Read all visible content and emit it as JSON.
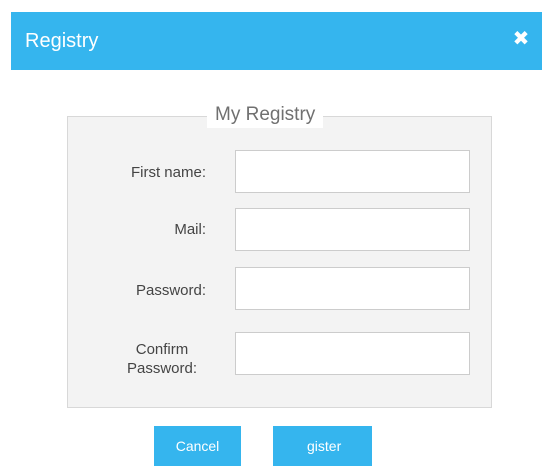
{
  "dialog": {
    "title": "Registry",
    "close_icon": "close-icon"
  },
  "form": {
    "legend": "My Registry",
    "fields": [
      {
        "label": "First name:",
        "value": ""
      },
      {
        "label": "Mail:",
        "value": ""
      },
      {
        "label": "Password:",
        "value": ""
      },
      {
        "label_line1": "Confirm",
        "label_line2": "Password:",
        "value": ""
      }
    ]
  },
  "buttons": {
    "cancel": "Cancel",
    "register": "gister"
  },
  "colors": {
    "accent": "#35b5ee",
    "panel": "#f3f3f3"
  }
}
